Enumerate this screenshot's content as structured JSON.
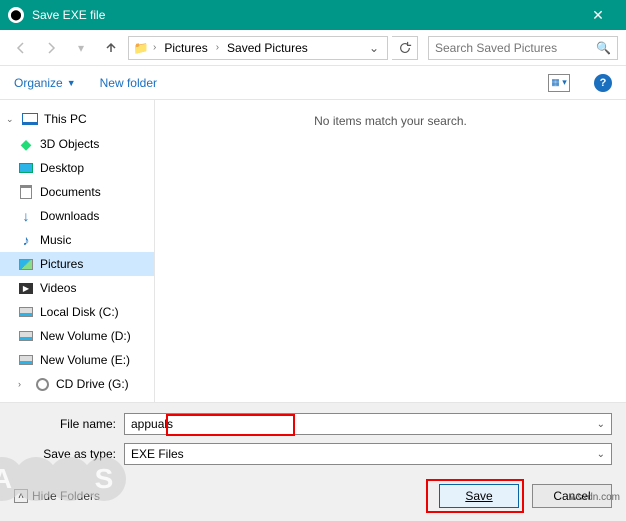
{
  "titlebar": {
    "title": "Save EXE file"
  },
  "nav": {
    "path1": "Pictures",
    "path2": "Saved Pictures",
    "search_placeholder": "Search Saved Pictures"
  },
  "toolbar": {
    "organize": "Organize",
    "newfolder": "New folder"
  },
  "tree": {
    "root": "This PC",
    "items": [
      "3D Objects",
      "Desktop",
      "Documents",
      "Downloads",
      "Music",
      "Pictures",
      "Videos",
      "Local Disk (C:)",
      "New Volume (D:)",
      "New Volume (E:)",
      "CD Drive (G:)"
    ]
  },
  "main": {
    "empty": "No items match your search."
  },
  "form": {
    "filename_label": "File name:",
    "filename_value": "appuals",
    "type_label": "Save as type:",
    "type_value": "EXE Files",
    "hide": "Hide Folders",
    "save": "Save",
    "cancel": "Cancel"
  },
  "watermark": "wsxdn.com"
}
